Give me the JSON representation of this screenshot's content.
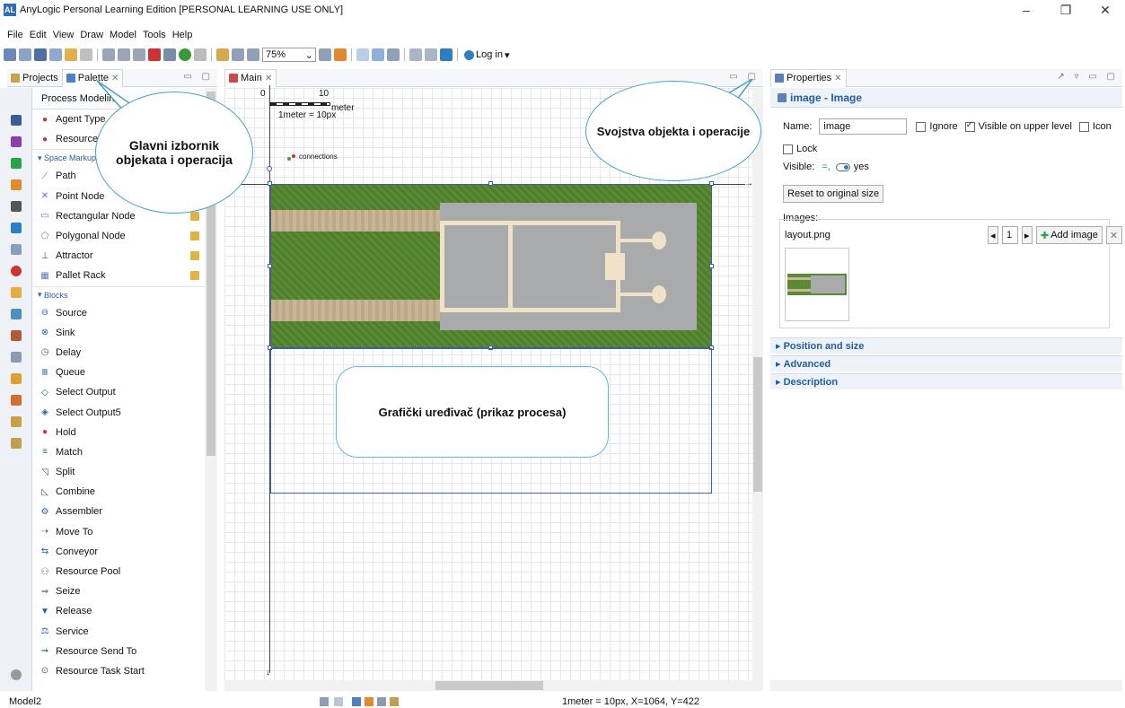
{
  "window": {
    "title": "AnyLogic Personal Learning Edition [PERSONAL LEARNING USE ONLY]",
    "controls": [
      "–",
      "❐",
      "✕"
    ]
  },
  "menu": [
    "File",
    "Edit",
    "View",
    "Draw",
    "Model",
    "Tools",
    "Help"
  ],
  "toolbar": {
    "zoom": "75%",
    "login": "Log in"
  },
  "left_panel": {
    "tabs": [
      "Projects",
      "Palette"
    ],
    "palette_header": "Process Modelin",
    "items_top": [
      "Agent Type",
      "Resource Ty"
    ],
    "space_markup_label": "Space Markup",
    "space_items": [
      "Path",
      "Point Node",
      "Rectangular Node",
      "Polygonal Node",
      "Attractor",
      "Pallet Rack"
    ],
    "blocks_label": "Blocks",
    "block_items": [
      "Source",
      "Sink",
      "Delay",
      "Queue",
      "Select Output",
      "Select Output5",
      "Hold",
      "Match",
      "Split",
      "Combine",
      "Assembler",
      "Move To",
      "Conveyor",
      "Resource Pool",
      "Seize",
      "Release",
      "Service",
      "Resource Send To",
      "Resource Task Start"
    ]
  },
  "editor": {
    "tab": "Main",
    "scale_labels": [
      "0",
      "10"
    ],
    "scale_unit": "meter",
    "scale_text": "1meter = 10px",
    "connections": "connections"
  },
  "callouts": {
    "main_menu": "Glavni izbornik objekata i operacija",
    "properties": "Svojstva objekta i operacije",
    "editor": "Grafički uređivač (prikaz procesa)"
  },
  "properties": {
    "tab": "Properties",
    "title": "image - Image",
    "name_label": "Name:",
    "name_value": "image",
    "ignore": "Ignore",
    "visible_upper": "Visible on upper level",
    "icon": "Icon",
    "lock": "Lock",
    "visible_label": "Visible:",
    "visible_value": "yes",
    "reset_btn": "Reset to original size",
    "images_label": "Images:",
    "image_file": "layout.png",
    "image_index": "1",
    "add_image": "Add image",
    "sections": [
      "Position and size",
      "Advanced",
      "Description"
    ]
  },
  "status": {
    "model": "Model2",
    "coords": "1meter = 10px, X=1064, Y=422"
  }
}
